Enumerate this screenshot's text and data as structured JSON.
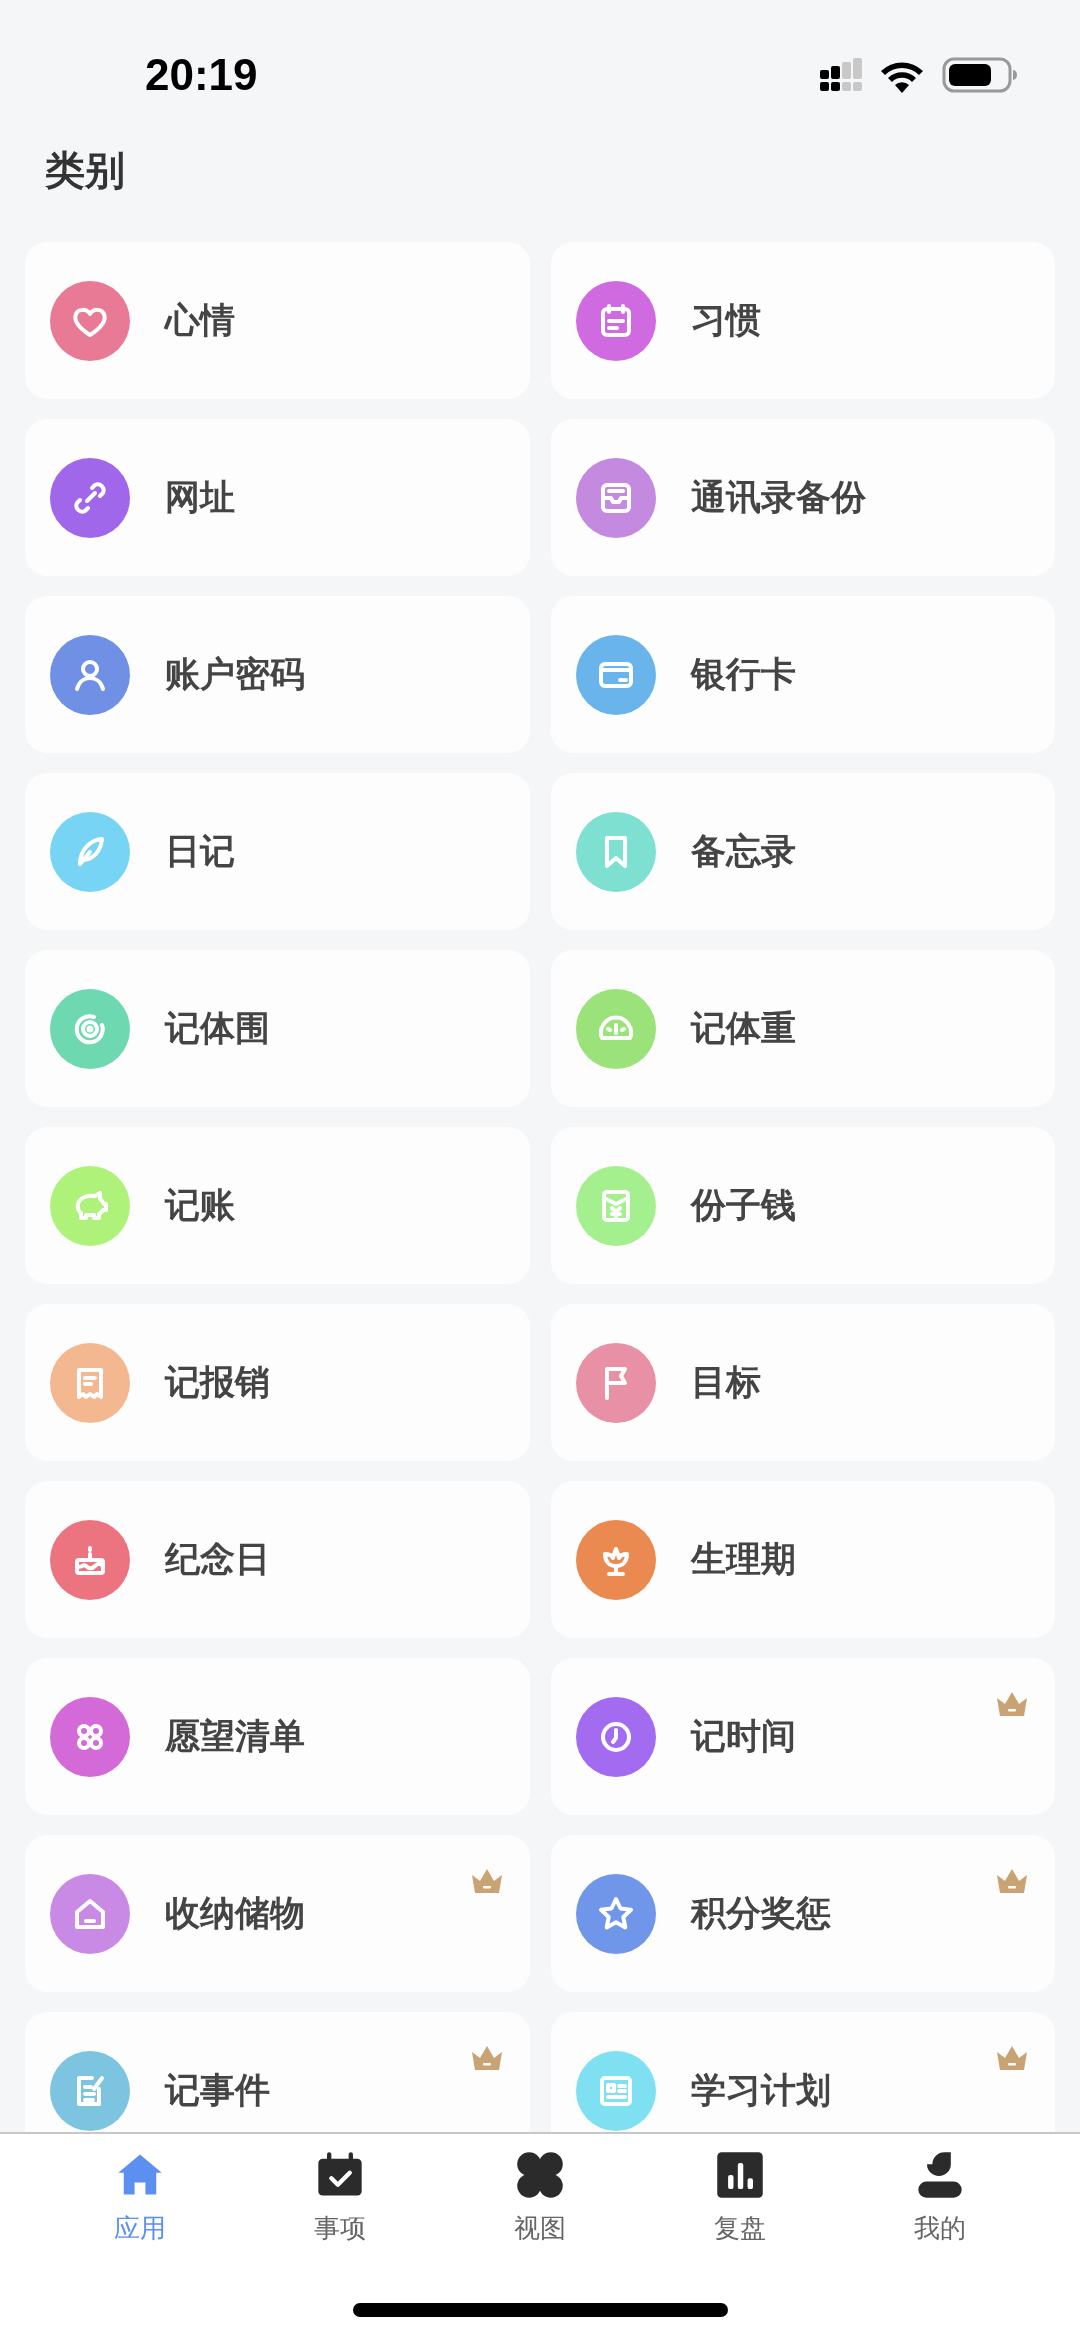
{
  "status_bar": {
    "time": "20:19"
  },
  "title": "类别",
  "categories": [
    {
      "label": "心情",
      "color": "#e97a95",
      "premium": false
    },
    {
      "label": "习惯",
      "color": "#d06ae0",
      "premium": false
    },
    {
      "label": "网址",
      "color": "#a067ea",
      "premium": false
    },
    {
      "label": "通讯录备份",
      "color": "#c48ae0",
      "premium": false
    },
    {
      "label": "账户密码",
      "color": "#7090e6",
      "premium": false
    },
    {
      "label": "银行卡",
      "color": "#6ab4ec",
      "premium": false
    },
    {
      "label": "日记",
      "color": "#78d4f4",
      "premium": false
    },
    {
      "label": "备忘录",
      "color": "#7ee0d0",
      "premium": false
    },
    {
      "label": "记体围",
      "color": "#6ed8b0",
      "premium": false
    },
    {
      "label": "记体重",
      "color": "#9be27a",
      "premium": false
    },
    {
      "label": "记账",
      "color": "#aef27a",
      "premium": false
    },
    {
      "label": "份子钱",
      "color": "#a5f08e",
      "premium": false
    },
    {
      "label": "记报销",
      "color": "#f4b890",
      "premium": false
    },
    {
      "label": "目标",
      "color": "#e890a6",
      "premium": false
    },
    {
      "label": "纪念日",
      "color": "#ec7480",
      "premium": false
    },
    {
      "label": "生理期",
      "color": "#ea8a50",
      "premium": false
    },
    {
      "label": "愿望清单",
      "color": "#d46ad8",
      "premium": false
    },
    {
      "label": "记时间",
      "color": "#a36cf0",
      "premium": true
    },
    {
      "label": "收纳储物",
      "color": "#c98ae6",
      "premium": true
    },
    {
      "label": "积分奖惩",
      "color": "#6f96e8",
      "premium": true
    },
    {
      "label": "记事件",
      "color": "#7cc4e0",
      "premium": true
    },
    {
      "label": "学习计划",
      "color": "#7ee0f0",
      "premium": true
    }
  ],
  "tabs": [
    {
      "label": "应用",
      "selected": true
    },
    {
      "label": "事项",
      "selected": false
    },
    {
      "label": "视图",
      "selected": false
    },
    {
      "label": "复盘",
      "selected": false
    },
    {
      "label": "我的",
      "selected": false
    }
  ]
}
